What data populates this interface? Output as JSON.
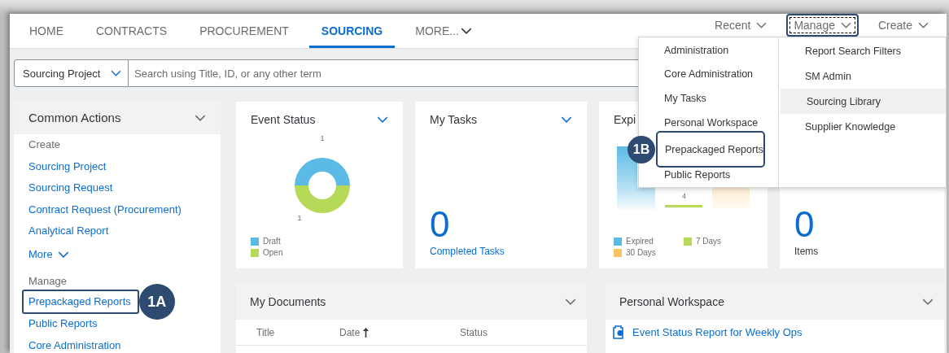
{
  "nav": {
    "tabs": [
      {
        "label": "HOME",
        "selected": false,
        "dropdown": false
      },
      {
        "label": "CONTRACTS",
        "selected": false,
        "dropdown": false
      },
      {
        "label": "PROCUREMENT",
        "selected": false,
        "dropdown": false
      },
      {
        "label": "SOURCING",
        "selected": true,
        "dropdown": false
      },
      {
        "label": "MORE...",
        "selected": false,
        "dropdown": true
      }
    ],
    "menus": [
      {
        "label": "Recent",
        "selected": false
      },
      {
        "label": "Manage",
        "selected": true
      },
      {
        "label": "Create",
        "selected": false
      }
    ]
  },
  "search": {
    "scope": "Sourcing Project",
    "placeholder": "Search using Title, ID, or any other term"
  },
  "common_actions": {
    "title": "Common Actions",
    "groups": [
      {
        "heading": "Create",
        "items": [
          {
            "label": "Sourcing Project",
            "highlighted": false
          },
          {
            "label": "Sourcing Request",
            "highlighted": false
          },
          {
            "label": "Contract Request (Procurement)",
            "highlighted": false
          },
          {
            "label": "Analytical Report",
            "highlighted": false
          }
        ],
        "more": "More"
      },
      {
        "heading": "Manage",
        "items": [
          {
            "label": "Prepackaged Reports",
            "highlighted": true,
            "callout": "1A"
          },
          {
            "label": "Public Reports",
            "highlighted": false
          },
          {
            "label": "Core Administration",
            "highlighted": false
          }
        ]
      }
    ]
  },
  "tiles": [
    {
      "kind": "donut",
      "title": "Event Status",
      "has_menu": true,
      "chart_data": {
        "type": "donut",
        "categories": [
          "Draft",
          "Open"
        ],
        "values": [
          1,
          1
        ],
        "data_labels": true
      },
      "legend": [
        {
          "color": "#5cbae6"
        },
        {
          "color": "#b6d957"
        }
      ]
    },
    {
      "kind": "count",
      "title": "My Tasks",
      "has_menu": true,
      "value": "0",
      "caption": "Completed Tasks",
      "caption_link": true
    },
    {
      "kind": "bars",
      "title": "Expi",
      "data_label": "4",
      "legend": [
        {
          "label": "Expired",
          "color": "#5cbae6"
        },
        {
          "label": "7 Days",
          "color": "#b6d957"
        },
        {
          "label": "30 Days",
          "color": "#fac364"
        }
      ]
    },
    {
      "kind": "count",
      "value": "0",
      "caption": "Items",
      "caption_link": false
    }
  ],
  "panels": [
    {
      "kind": "table",
      "title": "My Documents",
      "columns": [
        {
          "label": "Title",
          "sorted": false
        },
        {
          "label": "Date",
          "sorted": true
        },
        {
          "label": "Status",
          "sorted": false
        }
      ]
    },
    {
      "kind": "list",
      "title": "Personal Workspace",
      "items": [
        {
          "label": "Event Status Report for Weekly Ops"
        }
      ]
    }
  ],
  "manage_menu": {
    "columns": [
      [
        {
          "label": "Administration",
          "hovered": false,
          "highlighted": false
        },
        {
          "label": "Core Administration",
          "hovered": false,
          "highlighted": false
        },
        {
          "label": "My Tasks",
          "hovered": false,
          "highlighted": false
        },
        {
          "label": "Personal Workspace",
          "hovered": false,
          "highlighted": false
        },
        {
          "label": "Prepackaged Reports",
          "hovered": false,
          "highlighted": true,
          "callout": "1B"
        },
        {
          "label": "Public Reports",
          "hovered": false,
          "highlighted": false
        }
      ],
      [
        {
          "label": "Report Search Filters",
          "hovered": false,
          "highlighted": false
        },
        {
          "label": "SM Admin",
          "hovered": false,
          "highlighted": false
        },
        {
          "label": "Sourcing Library",
          "hovered": true,
          "highlighted": false
        },
        {
          "label": "Supplier Knowledge",
          "hovered": false,
          "highlighted": false
        }
      ]
    ]
  }
}
